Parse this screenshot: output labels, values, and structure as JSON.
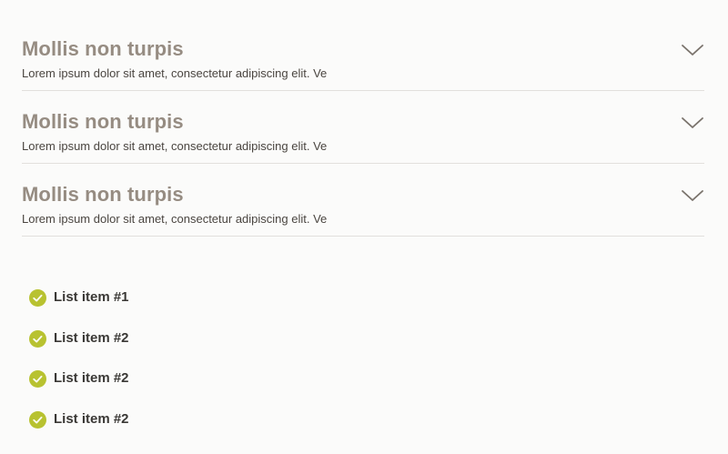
{
  "accordion": {
    "items": [
      {
        "title": "Mollis non turpis",
        "description": "Lorem ipsum dolor sit amet, consectetur adipiscing elit. Ve",
        "icon": "chevron-down-icon"
      },
      {
        "title": "Mollis non turpis",
        "description": "Lorem ipsum dolor sit amet, consectetur adipiscing elit. Ve",
        "icon": "chevron-down-icon"
      },
      {
        "title": "Mollis non turpis",
        "description": "Lorem ipsum dolor sit amet, consectetur adipiscing elit. Ve",
        "icon": "chevron-down-icon"
      }
    ]
  },
  "checklist": {
    "items": [
      {
        "label": "List item #1",
        "icon": "check-circle-icon"
      },
      {
        "label": "List item #2",
        "icon": "check-circle-icon"
      },
      {
        "label": "List item #2",
        "icon": "check-circle-icon"
      },
      {
        "label": "List item #2",
        "icon": "check-circle-icon"
      }
    ]
  },
  "colors": {
    "title": "#968c82",
    "text": "#4a4540",
    "check_accent": "#b8c230",
    "divider": "#e2e0dd"
  }
}
